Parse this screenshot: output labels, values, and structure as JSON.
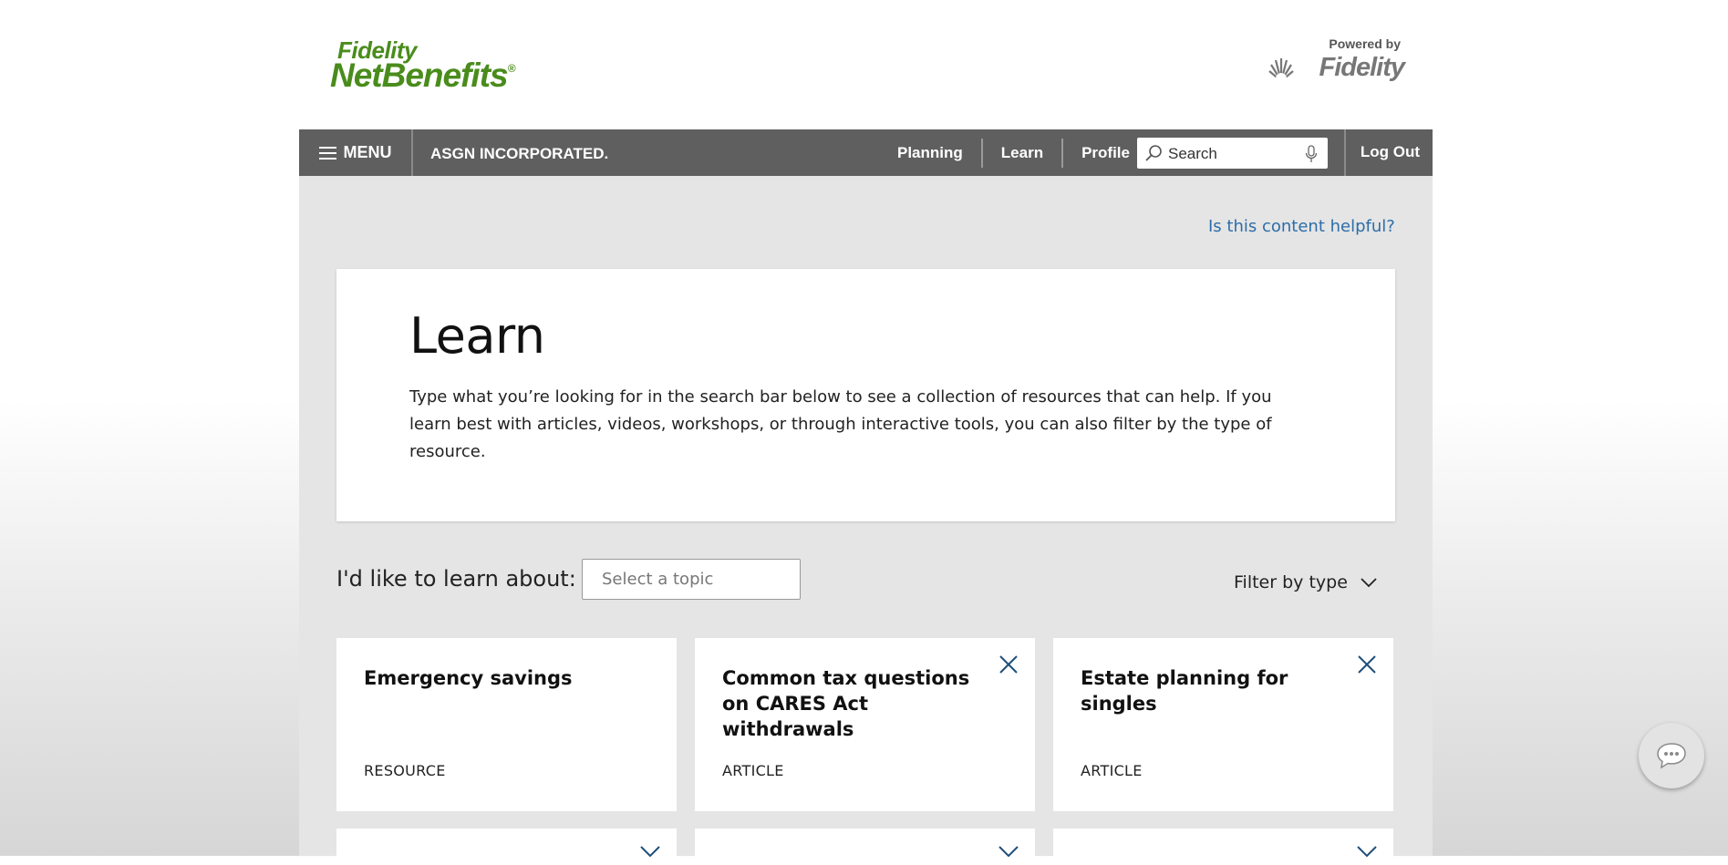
{
  "header": {
    "logo_line1": "Fidelity",
    "logo_line2": "NetBenefits",
    "logo_reg": "®",
    "powered_by": "Powered by",
    "powered_brand": "Fidelity"
  },
  "nav": {
    "menu_label": "MENU",
    "company": "ASGN INCORPORATED.",
    "links": [
      "Planning",
      "Learn",
      "Profile"
    ],
    "search_placeholder": "Search",
    "logout": "Log Out"
  },
  "feedback_link": "Is this content helpful?",
  "intro": {
    "title": "Learn",
    "description": "Type what you’re looking for in the search bar below to see a collection of resources that can help. If you learn best with articles, videos, workshops, or through interactive tools, you can also filter by the type of resource."
  },
  "topic_picker": {
    "label": "I'd like to learn about:",
    "placeholder": "Select a topic"
  },
  "filter_label": "Filter by type",
  "tiles": [
    {
      "title": "Emergency savings",
      "type": "RESOURCE"
    },
    {
      "title": "Common tax questions on CARES Act withdrawals",
      "type": "ARTICLE"
    },
    {
      "title": "Estate planning for singles",
      "type": "ARTICLE"
    }
  ],
  "colors": {
    "brand_green": "#4a8c1c",
    "nav_bg": "#5f5f5f",
    "link_blue": "#2d6da8",
    "page_bg": "#e5e5e5"
  }
}
